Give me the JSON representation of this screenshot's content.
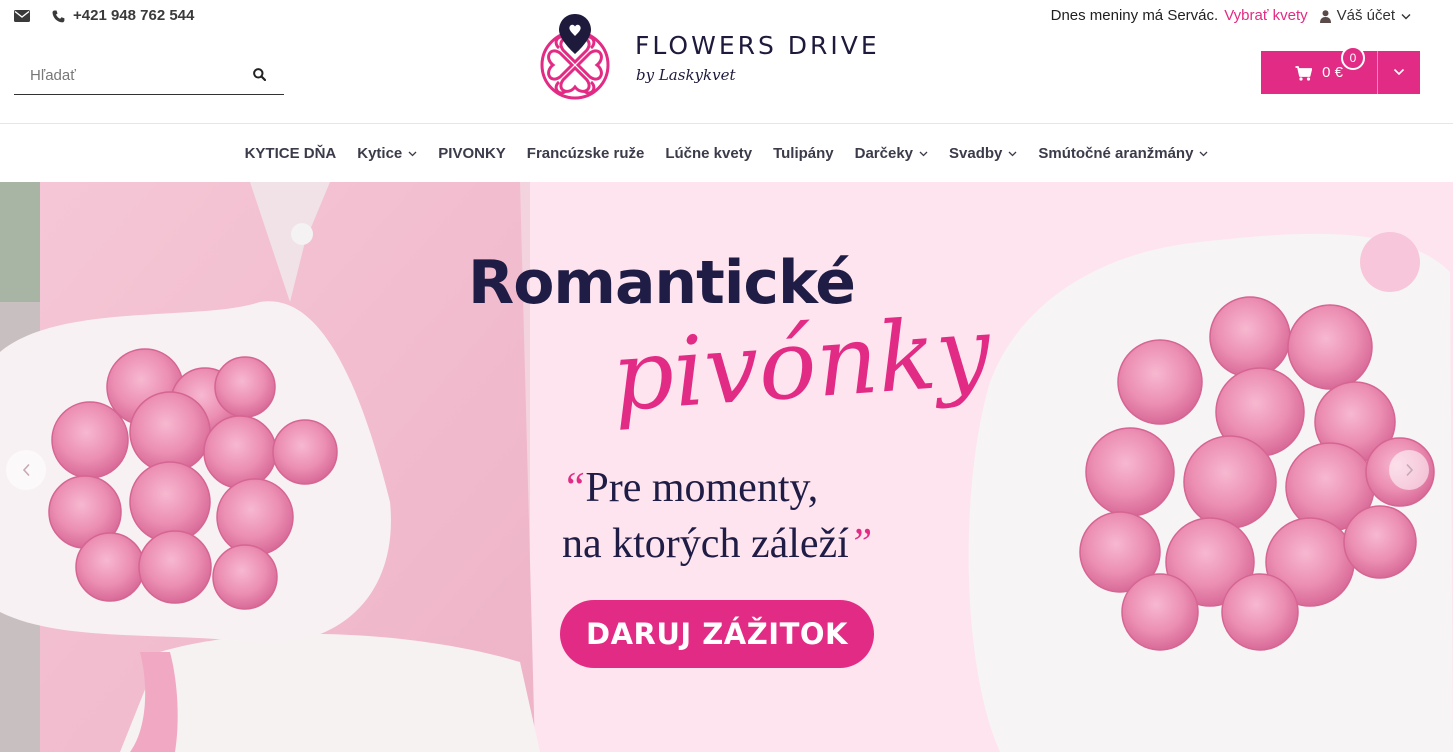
{
  "header": {
    "phone": "+421 948 762 544",
    "search_placeholder": "Hľadať",
    "logo": {
      "title": "FLOWERS DRIVE",
      "subtitle": "by Laskykvet"
    },
    "nameday_prefix": "Dnes meniny má Servác.",
    "nameday_link": "Vybrať kvety",
    "account_label": "Váš účet",
    "cart": {
      "total": "0 €",
      "count": "0"
    }
  },
  "nav": {
    "items": [
      {
        "label": "KYTICE DŇA",
        "has_dropdown": false
      },
      {
        "label": "Kytice",
        "has_dropdown": true
      },
      {
        "label": "PIVONKY",
        "has_dropdown": false
      },
      {
        "label": "Francúzske ruže",
        "has_dropdown": false
      },
      {
        "label": "Lúčne kvety",
        "has_dropdown": false
      },
      {
        "label": "Tulipány",
        "has_dropdown": false
      },
      {
        "label": "Darčeky",
        "has_dropdown": true
      },
      {
        "label": "Svadby",
        "has_dropdown": true
      },
      {
        "label": "Smútočné aranžmány",
        "has_dropdown": true
      }
    ]
  },
  "hero": {
    "headline": "Romantické",
    "script": "pivónky",
    "quote_line_1": "Pre momenty,",
    "quote_line_2": "na ktorých záleží",
    "quote_open": "“",
    "quote_close": "”",
    "cta": "DARUJ ZÁŽITOK"
  },
  "colors": {
    "accent": "#e22b84",
    "navy": "#1f1c45",
    "hero_bg": "#fde4ef"
  },
  "icons": [
    "envelope-icon",
    "phone-icon",
    "search-icon",
    "user-icon",
    "cart-icon",
    "chevron-down-icon",
    "chevron-left-icon",
    "chevron-right-icon"
  ]
}
